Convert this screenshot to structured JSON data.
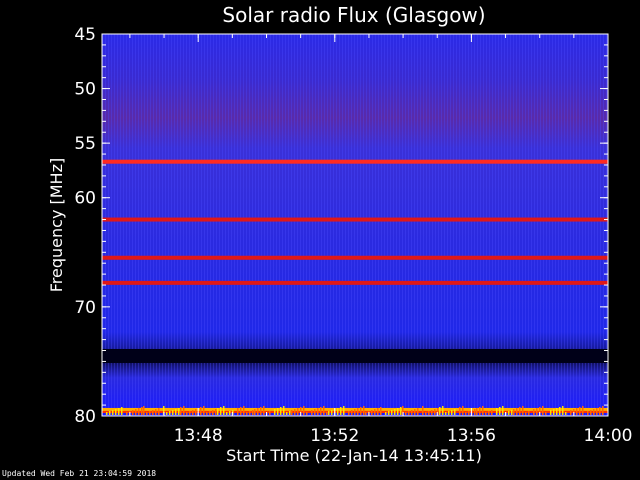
{
  "chart_data": {
    "type": "heatmap",
    "title": "Solar radio Flux (Glasgow)",
    "ylabel": "Frequency [MHz]",
    "xlabel": "Start Time (22-Jan-14 13:45:11)",
    "x_range": [
      "13:45:11",
      "14:00:00"
    ],
    "x_ticks": [
      "13:48",
      "13:52",
      "13:56",
      "14:00"
    ],
    "y_range": [
      45,
      80
    ],
    "y_inverted": true,
    "y_ticks": [
      45,
      50,
      55,
      60,
      70,
      80
    ],
    "colormap": [
      "#1a1aff",
      "#3030c8",
      "#7a1a8a",
      "#ff2020",
      "#ffd000"
    ],
    "features": [
      {
        "kind": "band",
        "frequency_mhz": 56.7,
        "intensity": "high"
      },
      {
        "kind": "band",
        "frequency_mhz": 62,
        "intensity": "medium"
      },
      {
        "kind": "band",
        "frequency_mhz": 65.5,
        "intensity": "medium"
      },
      {
        "kind": "band",
        "frequency_mhz": 67.8,
        "intensity": "medium"
      },
      {
        "kind": "band",
        "frequency_mhz": 74.5,
        "intensity": "low"
      },
      {
        "kind": "band",
        "frequency_mhz": 79.4,
        "intensity": "very-high"
      }
    ]
  },
  "footer": "Updated Wed Feb 21 23:04:59 2018"
}
